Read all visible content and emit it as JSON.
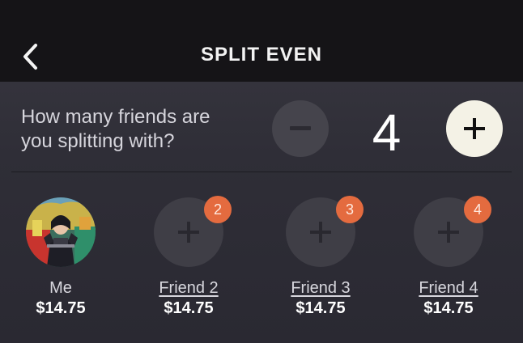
{
  "header": {
    "title": "SPLIT EVEN",
    "back_icon": "chevron-left-icon"
  },
  "question": {
    "line1": "How many friends are",
    "line2": "you splitting with?"
  },
  "stepper": {
    "value": "4",
    "decrement_icon": "minus-icon",
    "increment_icon": "plus-icon"
  },
  "people": [
    {
      "name": "Me",
      "amount": "$14.75"
    },
    {
      "name": "Friend 2",
      "badge": "2",
      "amount": "$14.75"
    },
    {
      "name": "Friend 3",
      "badge": "3",
      "amount": "$14.75"
    },
    {
      "name": "Friend 4",
      "badge": "4",
      "amount": "$14.75"
    }
  ],
  "colors": {
    "accent": "#e46b3f",
    "plus_button": "#f4f2e6",
    "topbar": "#151417"
  }
}
